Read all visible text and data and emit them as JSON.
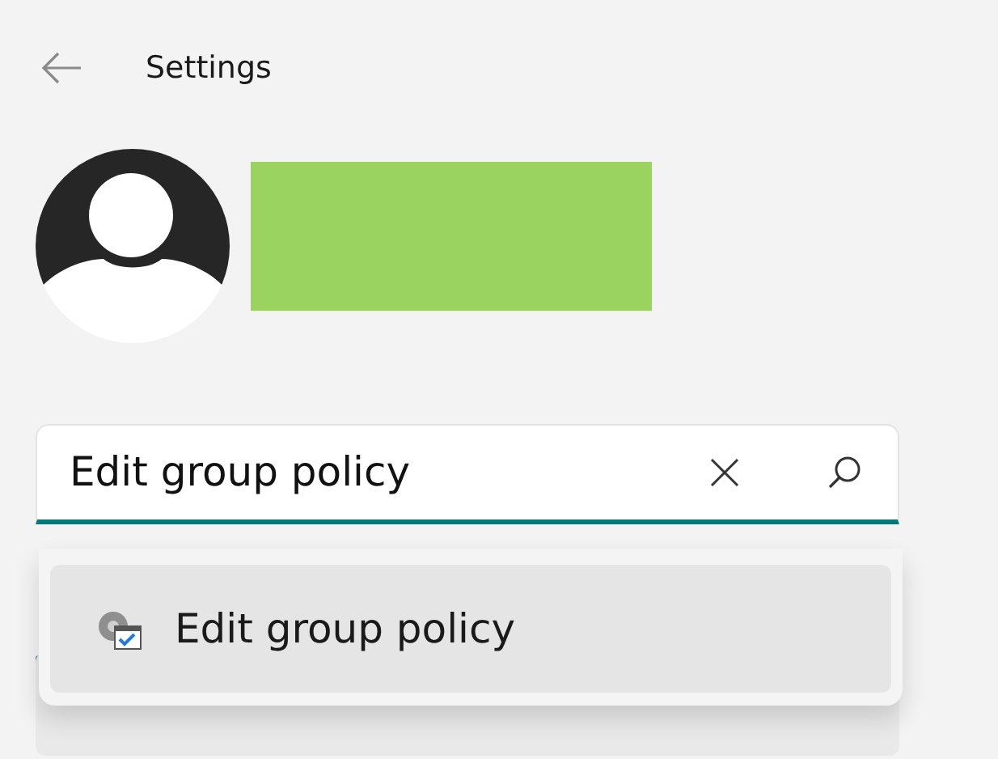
{
  "window": {
    "title": "Settings"
  },
  "search": {
    "value": "Edit group policy",
    "focused": true
  },
  "suggestions": [
    {
      "label": "Edit group policy",
      "selected": true
    }
  ],
  "nav": [
    {
      "selected": true
    }
  ]
}
